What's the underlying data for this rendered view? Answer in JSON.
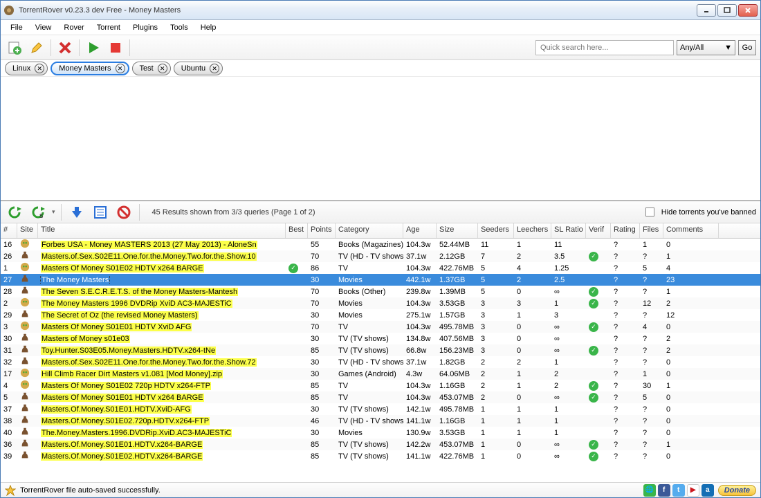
{
  "window": {
    "title": "TorrentRover v0.23.3 dev Free - Money Masters"
  },
  "menu": [
    "File",
    "View",
    "Rover",
    "Torrent",
    "Plugins",
    "Tools",
    "Help"
  ],
  "search": {
    "placeholder": "Quick search here...",
    "combo": "Any/All",
    "go": "Go"
  },
  "tags": [
    {
      "label": "Linux",
      "active": false
    },
    {
      "label": "Money Masters",
      "active": true
    },
    {
      "label": "Test",
      "active": false
    },
    {
      "label": "Ubuntu",
      "active": false
    }
  ],
  "mid": {
    "status": "45 Results shown from 3/3 queries (Page 1 of 2)",
    "hide_banned": "Hide torrents you've banned"
  },
  "columns": [
    "#",
    "Site",
    "Title",
    "Best",
    "Points",
    "Category",
    "Age",
    "Size",
    "Seeders",
    "Leechers",
    "SL Ratio",
    "Verif",
    "Rating",
    "Files",
    "Comments"
  ],
  "rows": [
    {
      "n": "16",
      "site": "kat",
      "title": "Forbes USA - Money MASTERS 2013 (27 May 2013) - AloneSn",
      "best": "",
      "pts": "55",
      "cat": "Books (Magazines)",
      "age": "104.3w",
      "size": "52.44MB",
      "seed": "11",
      "leech": "1",
      "sl": "11",
      "verif": "",
      "rating": "?",
      "files": "1",
      "comm": "0"
    },
    {
      "n": "26",
      "site": "tpb",
      "title": "Masters.of.Sex.S02E11.One.for.the.Money.Two.for.the.Show.10",
      "best": "",
      "pts": "70",
      "cat": "TV (HD - TV shows)",
      "age": "37.1w",
      "size": "2.12GB",
      "seed": "7",
      "leech": "2",
      "sl": "3.5",
      "verif": "ok",
      "rating": "?",
      "files": "?",
      "comm": "1"
    },
    {
      "n": "1",
      "site": "kat",
      "title": "Masters Of Money S01E02 HDTV x264 BARGE",
      "best": "ok",
      "pts": "86",
      "cat": "TV",
      "age": "104.3w",
      "size": "422.76MB",
      "seed": "5",
      "leech": "4",
      "sl": "1.25",
      "verif": "",
      "rating": "?",
      "files": "5",
      "comm": "4"
    },
    {
      "n": "27",
      "site": "tpb",
      "title": "The Money Masters",
      "best": "",
      "pts": "30",
      "cat": "Movies",
      "age": "442.1w",
      "size": "1.37GB",
      "seed": "5",
      "leech": "2",
      "sl": "2.5",
      "verif": "",
      "rating": "?",
      "files": "?",
      "comm": "23",
      "selected": true
    },
    {
      "n": "28",
      "site": "tpb",
      "title": "The Seven S.E.C.R.E.T.S. of the Money Masters-Mantesh",
      "best": "",
      "pts": "70",
      "cat": "Books (Other)",
      "age": "239.8w",
      "size": "1.39MB",
      "seed": "5",
      "leech": "0",
      "sl": "∞",
      "verif": "ok",
      "rating": "?",
      "files": "?",
      "comm": "1"
    },
    {
      "n": "2",
      "site": "kat",
      "title": "The Money Masters 1996 DVDRip XviD AC3-MAJESTiC",
      "best": "",
      "pts": "70",
      "cat": "Movies",
      "age": "104.3w",
      "size": "3.53GB",
      "seed": "3",
      "leech": "3",
      "sl": "1",
      "verif": "ok",
      "rating": "?",
      "files": "12",
      "comm": "2"
    },
    {
      "n": "29",
      "site": "tpb",
      "title": "The Secret of Oz (the revised Money Masters)",
      "best": "",
      "pts": "30",
      "cat": "Movies",
      "age": "275.1w",
      "size": "1.57GB",
      "seed": "3",
      "leech": "1",
      "sl": "3",
      "verif": "",
      "rating": "?",
      "files": "?",
      "comm": "12"
    },
    {
      "n": "3",
      "site": "kat",
      "title": "Masters Of Money S01E01 HDTV XviD AFG",
      "best": "",
      "pts": "70",
      "cat": "TV",
      "age": "104.3w",
      "size": "495.78MB",
      "seed": "3",
      "leech": "0",
      "sl": "∞",
      "verif": "ok",
      "rating": "?",
      "files": "4",
      "comm": "0"
    },
    {
      "n": "30",
      "site": "tpb",
      "title": "Masters of Money s01e03",
      "best": "",
      "pts": "30",
      "cat": "TV (TV shows)",
      "age": "134.8w",
      "size": "407.56MB",
      "seed": "3",
      "leech": "0",
      "sl": "∞",
      "verif": "",
      "rating": "?",
      "files": "?",
      "comm": "2"
    },
    {
      "n": "31",
      "site": "tpb",
      "title": "Toy.Hunter.S03E05.Money.Masters.HDTV.x264-tNe",
      "best": "",
      "pts": "85",
      "cat": "TV (TV shows)",
      "age": "66.8w",
      "size": "156.23MB",
      "seed": "3",
      "leech": "0",
      "sl": "∞",
      "verif": "ok",
      "rating": "?",
      "files": "?",
      "comm": "2"
    },
    {
      "n": "32",
      "site": "tpb",
      "title": "Masters.of.Sex.S02E11.One.for.the.Money.Two.for.the.Show.72",
      "best": "",
      "pts": "30",
      "cat": "TV (HD - TV shows)",
      "age": "37.1w",
      "size": "1.82GB",
      "seed": "2",
      "leech": "2",
      "sl": "1",
      "verif": "",
      "rating": "?",
      "files": "?",
      "comm": "0"
    },
    {
      "n": "17",
      "site": "kat",
      "title": "Hill Climb Racer Dirt Masters v1.081 [Mod Money].zip",
      "best": "",
      "pts": "30",
      "cat": "Games (Android)",
      "age": "4.3w",
      "size": "64.06MB",
      "seed": "2",
      "leech": "1",
      "sl": "2",
      "verif": "",
      "rating": "?",
      "files": "1",
      "comm": "0"
    },
    {
      "n": "4",
      "site": "kat",
      "title": "Masters Of Money S01E02 720p HDTV x264-FTP",
      "best": "",
      "pts": "85",
      "cat": "TV",
      "age": "104.3w",
      "size": "1.16GB",
      "seed": "2",
      "leech": "1",
      "sl": "2",
      "verif": "ok",
      "rating": "?",
      "files": "30",
      "comm": "1"
    },
    {
      "n": "5",
      "site": "tpb",
      "title": "Masters Of Money S01E01 HDTV x264 BARGE",
      "best": "",
      "pts": "85",
      "cat": "TV",
      "age": "104.3w",
      "size": "453.07MB",
      "seed": "2",
      "leech": "0",
      "sl": "∞",
      "verif": "ok",
      "rating": "?",
      "files": "5",
      "comm": "0"
    },
    {
      "n": "37",
      "site": "tpb",
      "title": "Masters.Of.Money.S01E01.HDTV.XviD-AFG",
      "best": "",
      "pts": "30",
      "cat": "TV (TV shows)",
      "age": "142.1w",
      "size": "495.78MB",
      "seed": "1",
      "leech": "1",
      "sl": "1",
      "verif": "",
      "rating": "?",
      "files": "?",
      "comm": "0"
    },
    {
      "n": "38",
      "site": "tpb",
      "title": "Masters.Of.Money.S01E02.720p.HDTV.x264-FTP",
      "best": "",
      "pts": "46",
      "cat": "TV (HD - TV shows)",
      "age": "141.1w",
      "size": "1.16GB",
      "seed": "1",
      "leech": "1",
      "sl": "1",
      "verif": "",
      "rating": "?",
      "files": "?",
      "comm": "0"
    },
    {
      "n": "40",
      "site": "tpb",
      "title": "The.Money.Masters.1996.DVDRip.XviD.AC3-MAJESTiC",
      "best": "",
      "pts": "30",
      "cat": "Movies",
      "age": "130.9w",
      "size": "3.53GB",
      "seed": "1",
      "leech": "1",
      "sl": "1",
      "verif": "",
      "rating": "?",
      "files": "?",
      "comm": "0"
    },
    {
      "n": "36",
      "site": "tpb",
      "title": "Masters.Of.Money.S01E01.HDTV.x264-BARGE",
      "best": "",
      "pts": "85",
      "cat": "TV (TV shows)",
      "age": "142.2w",
      "size": "453.07MB",
      "seed": "1",
      "leech": "0",
      "sl": "∞",
      "verif": "ok",
      "rating": "?",
      "files": "?",
      "comm": "1"
    },
    {
      "n": "39",
      "site": "tpb",
      "title": "Masters.Of.Money.S01E02.HDTV.x264-BARGE",
      "best": "",
      "pts": "85",
      "cat": "TV (TV shows)",
      "age": "141.1w",
      "size": "422.76MB",
      "seed": "1",
      "leech": "0",
      "sl": "∞",
      "verif": "ok",
      "rating": "?",
      "files": "?",
      "comm": "0"
    }
  ],
  "footer": {
    "status": "TorrentRover file auto-saved successfully.",
    "donate": "Donate"
  }
}
